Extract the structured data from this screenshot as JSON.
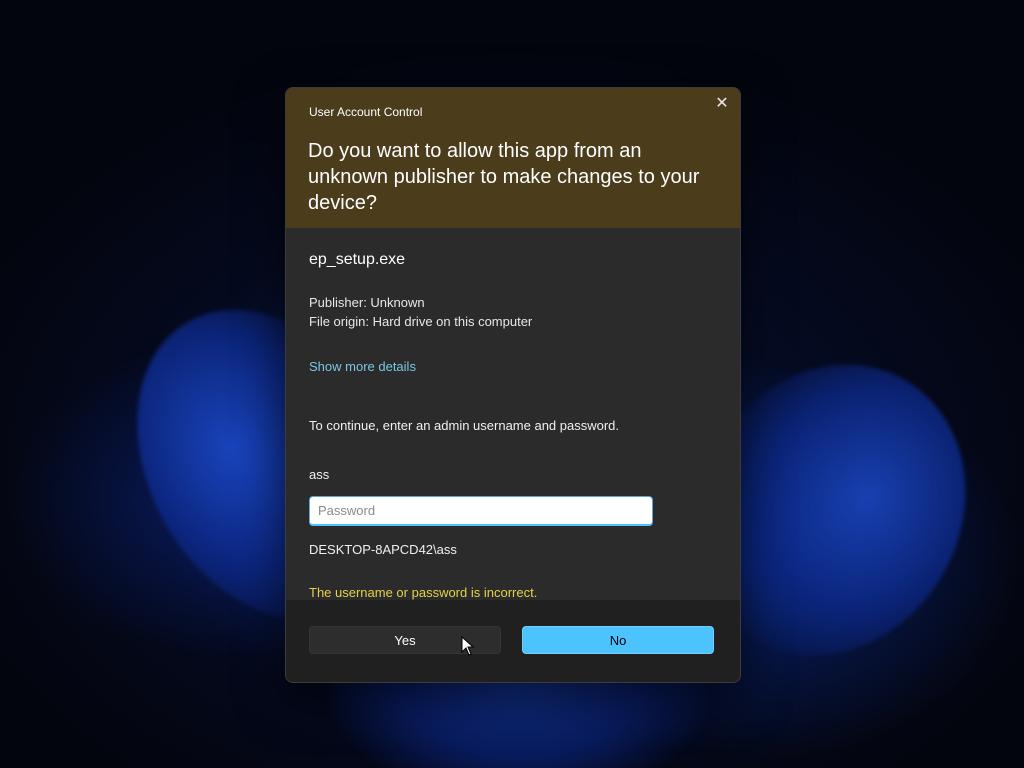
{
  "dialog": {
    "app_title": "User Account Control",
    "question": "Do you want to allow this app from an unknown publisher to make changes to your device?",
    "close_icon": "close-icon",
    "exe_name": "ep_setup.exe",
    "publisher": "Publisher: Unknown",
    "file_origin": "File origin: Hard drive on this computer",
    "show_more": "Show more details",
    "instruction": "To continue, enter an admin username and password.",
    "username": "ass",
    "password": {
      "value": "",
      "placeholder": "Password"
    },
    "domain_user": "DESKTOP-8APCD42\\ass",
    "error": "The username or password is incorrect.",
    "yes_label": "Yes",
    "no_label": "No"
  },
  "colors": {
    "header_bg": "#4b3c1c",
    "body_bg": "#2b2b2b",
    "footer_bg": "#202020",
    "link": "#78c8e6",
    "error": "#e6d24a",
    "accent_button": "#4cc2ff"
  }
}
